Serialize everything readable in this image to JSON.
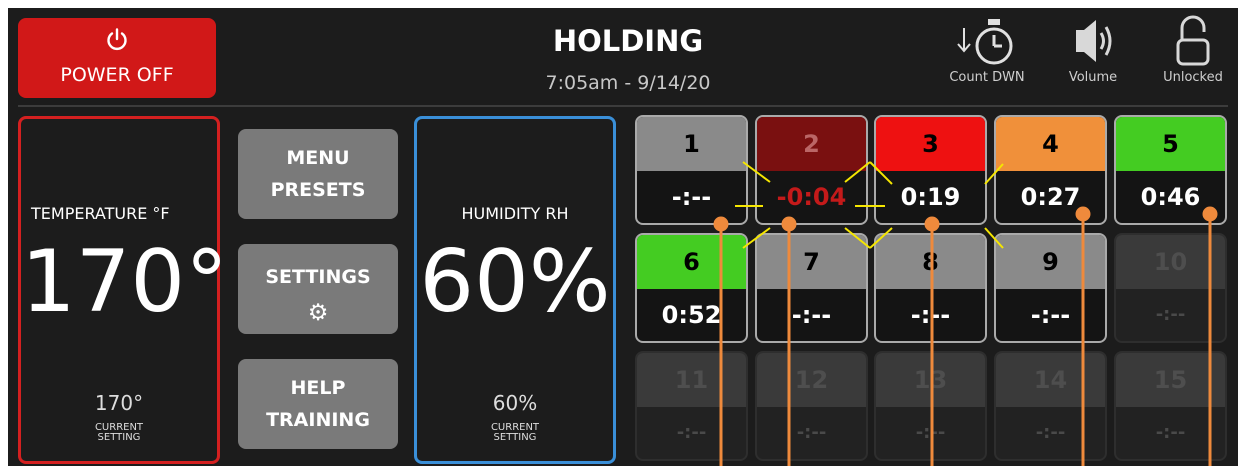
{
  "header": {
    "power_label": "POWER OFF",
    "title": "HOLDING",
    "datetime": "7:05am - 9/14/20",
    "countdown_label": "Count DWN",
    "volume_label": "Volume",
    "lock_label": "Unlocked"
  },
  "temperature": {
    "label": "TEMPERATURE   °F",
    "value": "170°",
    "setting_value": "170°",
    "setting_line1": "CURRENT",
    "setting_line2": "SETTING"
  },
  "humidity": {
    "label": "HUMIDITY  RH",
    "value": "60%",
    "setting_value": "60%",
    "setting_line1": "CURRENT",
    "setting_line2": "SETTING"
  },
  "menu": {
    "presets_line1": "MENU",
    "presets_line2": "PRESETS",
    "settings_label": "SETTINGS",
    "help_line1": "HELP",
    "help_line2": "TRAINING"
  },
  "tiles": [
    {
      "number": "1",
      "time": "-:--",
      "color": "#8a8a8a"
    },
    {
      "number": "2",
      "time": "-0:04",
      "color": "#7a1010"
    },
    {
      "number": "3",
      "time": "0:19",
      "color": "#ee1111"
    },
    {
      "number": "4",
      "time": "0:27",
      "color": "#f0903a"
    },
    {
      "number": "5",
      "time": "0:46",
      "color": "#44cc22"
    },
    {
      "number": "6",
      "time": "0:52",
      "color": "#44cc22"
    },
    {
      "number": "7",
      "time": "-:--",
      "color": "#8a8a8a"
    },
    {
      "number": "8",
      "time": "-:--",
      "color": "#8a8a8a"
    },
    {
      "number": "9",
      "time": "-:--",
      "color": "#8a8a8a"
    },
    {
      "number": "10",
      "time": "-:--",
      "color": "#3a3a3a"
    },
    {
      "number": "11",
      "time": "-:--",
      "color": "#3a3a3a"
    },
    {
      "number": "12",
      "time": "-:--",
      "color": "#3a3a3a"
    },
    {
      "number": "13",
      "time": "-:--",
      "color": "#3a3a3a"
    },
    {
      "number": "14",
      "time": "-:--",
      "color": "#3a3a3a"
    },
    {
      "number": "15",
      "time": "-:--",
      "color": "#3a3a3a"
    }
  ],
  "colors": {
    "power": "#d11818",
    "temperature_border": "#d42020",
    "humidity_border": "#3a8fd8",
    "callout": "#ef8a3c",
    "highlight": "#f5e600",
    "expired_text": "#c41a1a"
  }
}
